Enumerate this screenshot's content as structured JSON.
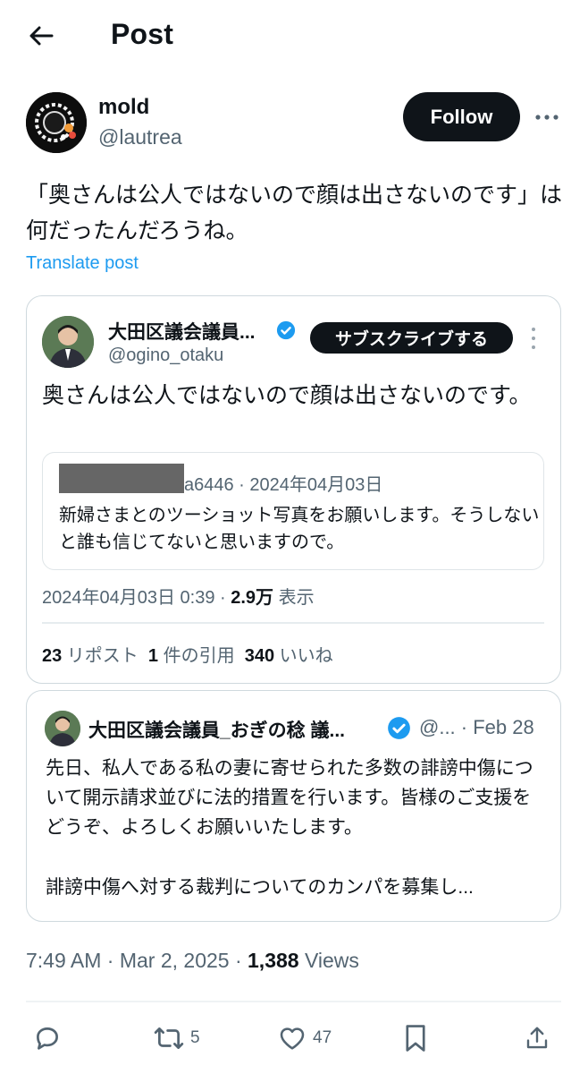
{
  "header": {
    "title": "Post"
  },
  "author": {
    "name": "mold",
    "handle": "@lautrea",
    "follow_label": "Follow"
  },
  "post": {
    "text": "「奥さんは公人ではないので顔は出さないのです」は何だったんだろうね。",
    "translate_label": "Translate post",
    "meta": {
      "time": "7:49 AM · Mar 2, 2025 · ",
      "views_count": "1,388",
      "views_label": " Views"
    }
  },
  "image_card": {
    "name": "大田区議会議員...",
    "handle": "@ogino_otaku",
    "subscribe_label": "サブスクライブする",
    "text": "奥さんは公人ではないので顔は出さないのです。",
    "inner_quote": {
      "meta": "a6446 · 2024年04月03日",
      "text": "新婦さまとのツーショット写真をお願いします。そうしないと誰も信じてないと思いますので。"
    },
    "date": "2024年04月03日 0:39 · ",
    "views_count": "2.9万",
    "views_label": " 表示",
    "stats": {
      "reposts_count": "23",
      "reposts_label": " リポスト  ",
      "quotes_count": "1",
      "quotes_label": " 件の引用  ",
      "likes_count": "340",
      "likes_label": " いいね"
    }
  },
  "quote_card": {
    "name": "大田区議会議員_おぎの稔 議...",
    "meta": "@... · Feb 28",
    "text": "先日、私人である私の妻に寄せられた多数の誹謗中傷について開示請求並びに法的措置を行います。皆様のご支援をどうぞ、よろしくお願いいたします。",
    "text2": "誹謗中傷へ対する裁判についてのカンパを募集し..."
  },
  "actions": {
    "reposts": "5",
    "likes": "47"
  },
  "colors": {
    "accent": "#1d9bf0",
    "text": "#0f1419",
    "muted": "#536471"
  }
}
